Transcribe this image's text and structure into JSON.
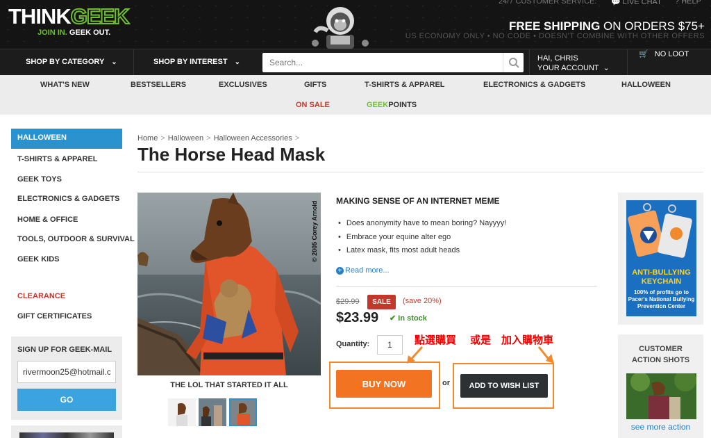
{
  "header": {
    "logo_think": "THINK",
    "logo_geek": "GEEK",
    "tagline_a": "JOIN IN.",
    "tagline_b": "GEEK OUT.",
    "customer_service": "24/7 CUSTOMER SERVICE:",
    "live_chat": "LIVE CHAT",
    "help": "HELP",
    "free_shipping_bold": "FREE SHIPPING",
    "free_shipping_rest": " ON ORDERS $75+",
    "shipping_note": "US ECONOMY ONLY • NO CODE • DOESN'T COMBINE WITH OTHER OFFERS"
  },
  "nav": {
    "shop_by_category": "SHOP BY CATEGORY",
    "shop_by_interest": "SHOP BY INTEREST",
    "search_placeholder": "Search...",
    "account_greeting": "HAI, CHRIS",
    "account_label": "YOUR ACCOUNT",
    "cart_label": "NO LOOT"
  },
  "categories": {
    "whats_new": "WHAT'S NEW",
    "bestsellers": "BESTSELLERS",
    "exclusives": "EXCLUSIVES",
    "gifts": "GIFTS",
    "tshirts": "T-SHIRTS & APPAREL",
    "electronics": "ELECTRONICS & GADGETS",
    "halloween": "HALLOWEEN",
    "on_sale": "ON SALE",
    "geek_points_a": "GEEK",
    "geek_points_b": "POINTS"
  },
  "sidebar": {
    "items": [
      "HALLOWEEN",
      "T-SHIRTS & APPAREL",
      "GEEK TOYS",
      "ELECTRONICS & GADGETS",
      "HOME & OFFICE",
      "TOOLS, OUTDOOR & SURVIVAL",
      "GEEK KIDS"
    ],
    "clearance": "CLEARANCE",
    "gift_certificates": "GIFT CERTIFICATES",
    "signup_label": "SIGN UP FOR GEEK-MAIL",
    "signup_email": "rivermoon25@hotmail.c",
    "signup_button": "GO"
  },
  "breadcrumb": [
    "Home",
    "Halloween",
    "Halloween Accessories"
  ],
  "product": {
    "title": "The Horse Head Mask",
    "photo_credit": "© 2005 Corey Arnold",
    "caption": "THE LOL THAT STARTED IT ALL",
    "subhead": "MAKING SENSE OF AN INTERNET MEME",
    "bullets": [
      "Does anonymity have to mean boring? Nayyyy!",
      "Embrace your equine alter ego",
      "Latex mask, fits most adult heads"
    ],
    "read_more": "Read more...",
    "old_price": "$29.99",
    "sale_badge": "SALE",
    "save_text": "(save 20%)",
    "price": "$23.99",
    "stock": "In stock",
    "quantity_label": "Quantity:",
    "quantity_value": "1",
    "buy_now": "BUY NOW",
    "or_text": "or",
    "wish_list": "ADD TO WISH LIST"
  },
  "annotations": {
    "left": "點選購買",
    "middle": "或是",
    "right": "加入購物車"
  },
  "right_column": {
    "ad_title": "ANTI-BULLYING KEYCHAIN",
    "ad_sub": "100% of profits go to Pacer's National Bullying Prevention Center",
    "customer_shots_a": "CUSTOMER",
    "customer_shots_b": "ACTION SHOTS",
    "see_more": "see more action"
  },
  "colors": {
    "accent_green": "#6fbf2c",
    "accent_blue": "#2a93cf",
    "buy_orange": "#f27422",
    "sale_red": "#c0392b"
  }
}
